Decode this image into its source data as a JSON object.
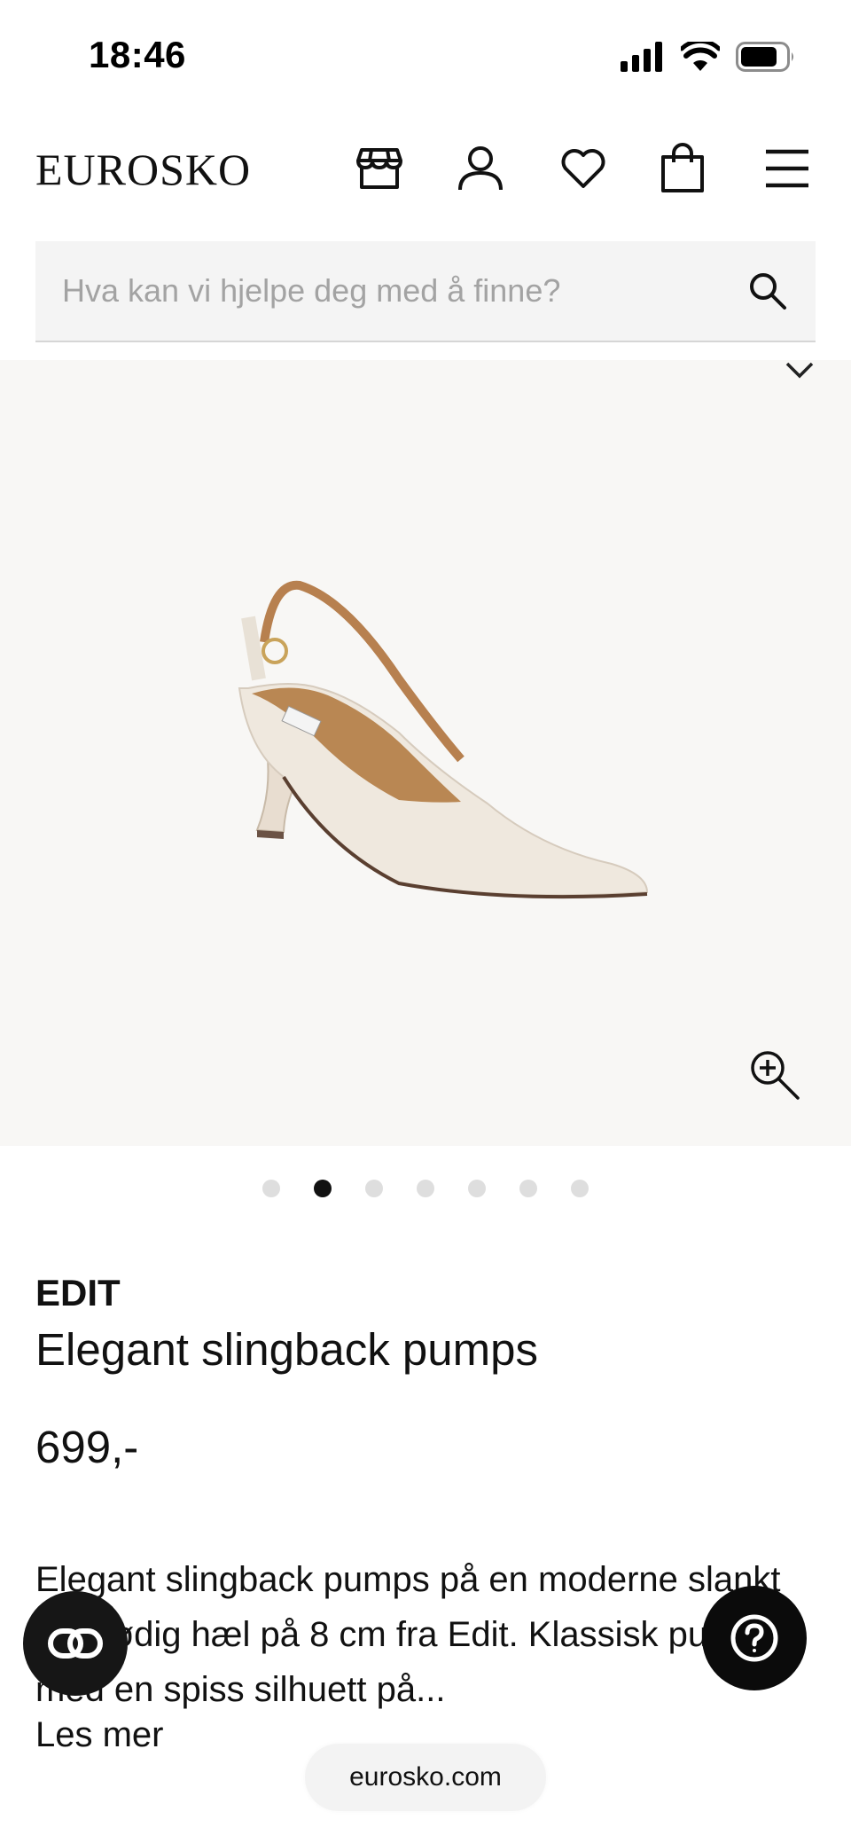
{
  "status_bar": {
    "time": "18:46",
    "icons": [
      "cellular-signal-icon",
      "wifi-icon",
      "battery-icon"
    ]
  },
  "header": {
    "logo": "EUROSKO",
    "icons": [
      "store-icon",
      "account-icon",
      "heart-icon",
      "bag-icon",
      "menu-icon"
    ]
  },
  "search": {
    "placeholder": "Hva kan vi hjelpe deg med å finne?",
    "value": ""
  },
  "gallery": {
    "image": "cream slingback pump",
    "total_images": 7,
    "active_index": 1,
    "icons": [
      "chevron-down-icon",
      "zoom-in-icon"
    ]
  },
  "product": {
    "brand": "EDIT",
    "name": "Elegant slingback pumps",
    "price": "699,-",
    "description": "Elegant slingback pumps på en moderne slankt og stødig hæl på 8 cm fra Edit. Klassisk pumps med en spiss silhuett på...",
    "read_more": "Les mer"
  },
  "floating": {
    "left_icon": "link-icon",
    "right_icon": "help-icon"
  },
  "browser": {
    "url": "eurosko.com"
  },
  "colors": {
    "text": "#111111",
    "search_bg": "#f4f4f4",
    "image_bg": "#f8f7f5",
    "dot_inactive": "#dedede",
    "dot_active": "#111111",
    "fab_bg": "#111111"
  }
}
